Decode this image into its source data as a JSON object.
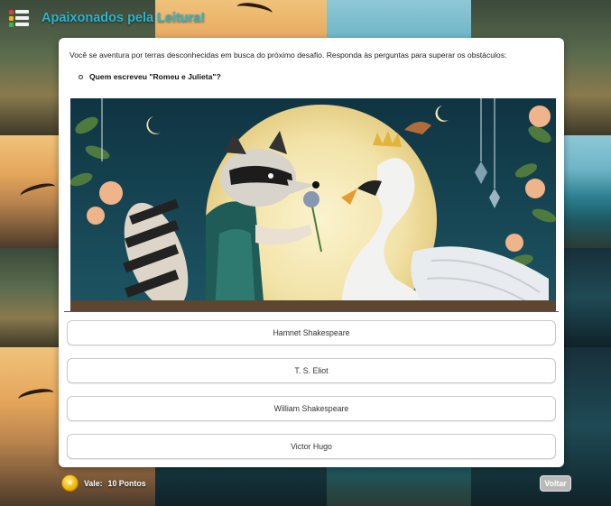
{
  "app": {
    "title": "Apaixonados pela Leitura!",
    "logo_colors": [
      "#e23b3b",
      "#f2b705",
      "#3bb54a"
    ]
  },
  "quiz": {
    "intro": "Você se aventura por terras desconhecidas em busca do próximo desafio. Responda às perguntas para superar os obstáculos:",
    "question": "Quem escreveu \"Romeu e Julieta\"?",
    "answers": [
      {
        "label": "Hamnet Shakespeare"
      },
      {
        "label": "T. S. Eliot"
      },
      {
        "label": "William Shakespeare"
      },
      {
        "label": "Victor Hugo"
      }
    ]
  },
  "footer": {
    "points_prefix": "Vale:",
    "points_value": "10 Pontos",
    "back_label": "Voltar"
  },
  "colors": {
    "title": "#2ab4cf",
    "card": "#ffffff",
    "answer_border": "#c9c9c9",
    "back_button": "#b9b9b9",
    "coin": "#f2b705"
  }
}
